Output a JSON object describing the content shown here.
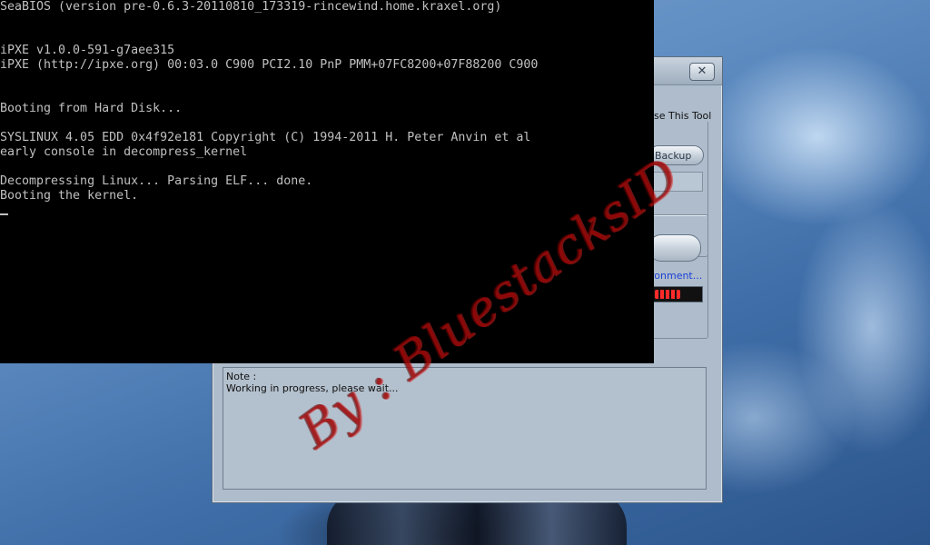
{
  "console": {
    "lines": [
      "SeaBIOS (version pre-0.6.3-20110810_173319-rincewind.home.kraxel.org)",
      "",
      "",
      "iPXE v1.0.0-591-g7aee315",
      "iPXE (http://ipxe.org) 00:03.0 C900 PCI2.10 PnP PMM+07FC8200+07F88200 C900",
      "",
      "",
      "Booting from Hard Disk...",
      "",
      "SYSLINUX 4.05 EDD 0x4f92e181 Copyright (C) 1994-2011 H. Peter Anvin et al",
      "early console in decompress_kernel",
      "",
      "Decompressing Linux... Parsing ELF... done.",
      "Booting the kernel."
    ]
  },
  "app": {
    "group_title": "se This Tool",
    "backup_label": "Backup",
    "env_link": "ronment...",
    "progress_percent": 55,
    "note_label": "Note :",
    "note_text": "Working in progress, please wait...",
    "close_glyph": "✕"
  },
  "watermark": {
    "text": "By : BluestacksID",
    "color": "#9a0000"
  },
  "colors": {
    "console_bg": "#000000",
    "console_fg": "#c0c0c0",
    "window_bg": "#aebccb",
    "link": "#1b3fd6",
    "progress": "#ff2a2a"
  }
}
